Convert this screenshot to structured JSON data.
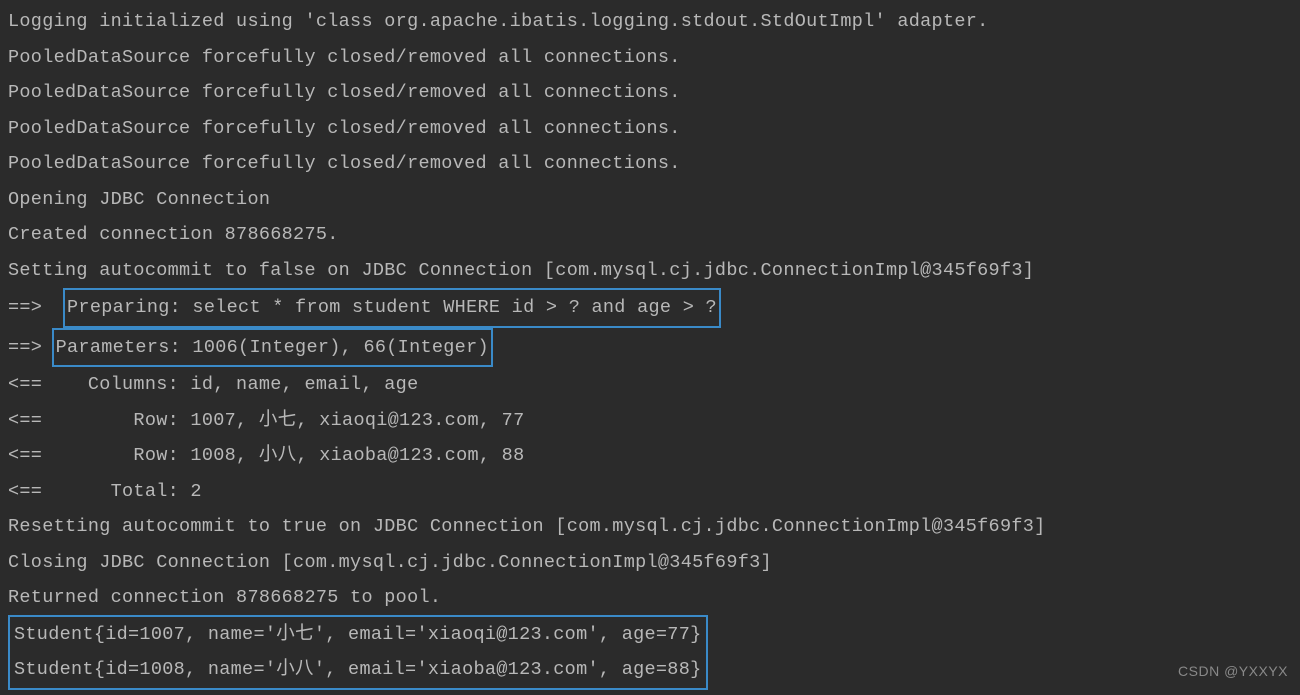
{
  "lines": {
    "l1": "Logging initialized using 'class org.apache.ibatis.logging.stdout.StdOutImpl' adapter.",
    "l2": "PooledDataSource forcefully closed/removed all connections.",
    "l3": "PooledDataSource forcefully closed/removed all connections.",
    "l4": "PooledDataSource forcefully closed/removed all connections.",
    "l5": "PooledDataSource forcefully closed/removed all connections.",
    "l6": "Opening JDBC Connection",
    "l7": "Created connection 878668275.",
    "l8": "Setting autocommit to false on JDBC Connection [com.mysql.cj.jdbc.ConnectionImpl@345f69f3]",
    "l9_prefix": "==>  ",
    "l9_box": "Preparing: select * from student WHERE id > ? and age > ?",
    "l10_prefix": "==> ",
    "l10_box": "Parameters: 1006(Integer), 66(Integer)",
    "l11": "<==    Columns: id, name, email, age",
    "l12": "<==        Row: 1007, 小七, xiaoqi@123.com, 77",
    "l13": "<==        Row: 1008, 小八, xiaoba@123.com, 88",
    "l14": "<==      Total: 2",
    "l15": "Resetting autocommit to true on JDBC Connection [com.mysql.cj.jdbc.ConnectionImpl@345f69f3]",
    "l16": "Closing JDBC Connection [com.mysql.cj.jdbc.ConnectionImpl@345f69f3]",
    "l17": "Returned connection 878668275 to pool.",
    "l18": "Student{id=1007, name='小七', email='xiaoqi@123.com', age=77}",
    "l19": "Student{id=1008, name='小八', email='xiaoba@123.com', age=88}"
  },
  "watermark": "CSDN @YXXYX"
}
